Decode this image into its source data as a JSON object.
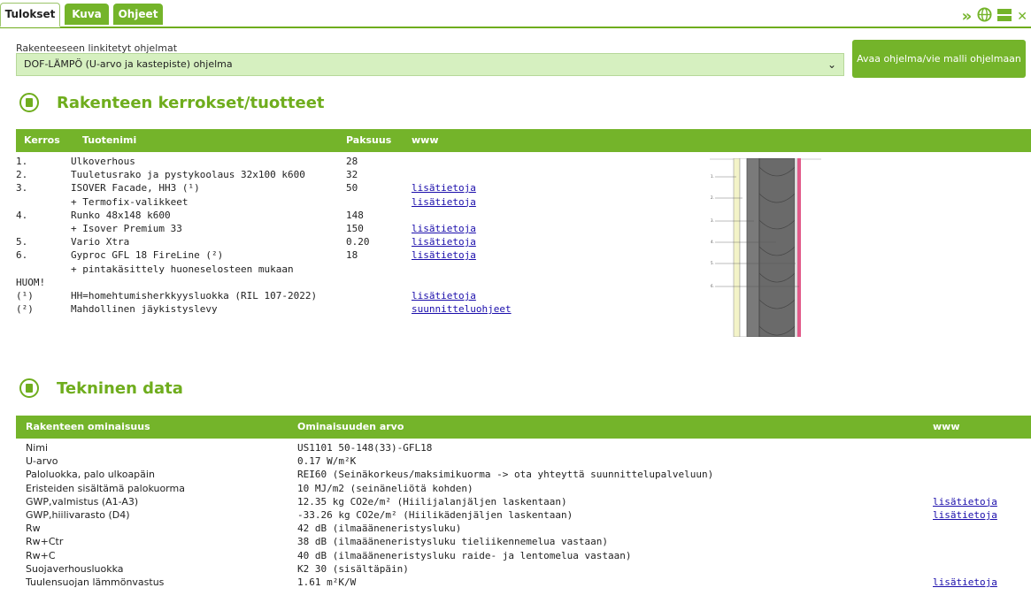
{
  "tabs": [
    {
      "label": "Tulokset",
      "active": true
    },
    {
      "label": "Kuva",
      "active": false
    },
    {
      "label": "Ohjeet",
      "active": false
    }
  ],
  "toolbar_icons": [
    "double-chevron-right-icon",
    "globe-icon",
    "menu-icon",
    "close-icon"
  ],
  "program": {
    "label": "Rakenteeseen linkitetyt ohjelmat",
    "selected": "DOF-LÄMPÖ (U-arvo ja kastepiste) ohjelma",
    "button": "Avaa ohjelma/vie malli ohjelmaan"
  },
  "layers": {
    "title": "Rakenteen kerrokset/tuotteet",
    "headers": {
      "kerros": "Kerros",
      "tuotenimi": "Tuotenimi",
      "paksuus": "Paksuus",
      "www": "www"
    },
    "rows": [
      {
        "k": "1.",
        "name": "Ulkoverhous",
        "p": "28",
        "w": ""
      },
      {
        "k": "2.",
        "name": "Tuuletusrako ja pystykoolaus 32x100 k600",
        "p": "32",
        "w": ""
      },
      {
        "k": "3.",
        "name": "ISOVER Facade, HH3 (¹)",
        "p": "50",
        "w": "lisätietoja"
      },
      {
        "k": "",
        "name": "+ Termofix-valikkeet",
        "p": "",
        "w": "lisätietoja"
      },
      {
        "k": "4.",
        "name": "Runko 48x148 k600",
        "p": "148",
        "w": ""
      },
      {
        "k": "",
        "name": "+ Isover Premium 33",
        "p": "150",
        "w": "lisätietoja"
      },
      {
        "k": "5.",
        "name": "Vario Xtra",
        "p": "0.20",
        "w": "lisätietoja"
      },
      {
        "k": "6.",
        "name": "Gyproc GFL 18 FireLine (²)",
        "p": "18",
        "w": "lisätietoja"
      },
      {
        "k": "",
        "name": "+ pintakäsittely huoneselosteen mukaan",
        "p": "",
        "w": ""
      },
      {
        "k": "HUOM!",
        "name": "",
        "p": "",
        "w": ""
      },
      {
        "k": "(¹)",
        "name": "HH=homehtumisherkkyysluokka (RIL 107-2022)",
        "p": "",
        "w": "lisätietoja"
      },
      {
        "k": "(²)",
        "name": "Mahdollinen jäykistyslevy",
        "p": "",
        "w": "suunnitteluohjeet"
      }
    ]
  },
  "diagram_labels": [
    "1.",
    "2.",
    "3.",
    "4.",
    "5.",
    "6."
  ],
  "tech": {
    "title": "Tekninen data",
    "headers": {
      "prop": "Rakenteen ominaisuus",
      "value": "Ominaisuuden arvo",
      "www": "www"
    },
    "rows": [
      {
        "prop": "Nimi",
        "value": "US1101 50-148(33)-GFL18",
        "w": ""
      },
      {
        "prop": "U-arvo",
        "value": "0.17 W/m²K",
        "w": ""
      },
      {
        "prop": "Paloluokka, palo ulkoapäin",
        "value": "REI60 (Seinäkorkeus/maksimikuorma -> ota yhteyttä suunnittelupalveluun)",
        "w": ""
      },
      {
        "prop": "Eristeiden sisältämä palokuorma",
        "value": "10 MJ/m2 (seinäneliötä kohden)",
        "w": ""
      },
      {
        "prop": "GWP,valmistus (A1-A3)",
        "value": "12.35 kg CO2e/m² (Hiilijalanjäljen laskentaan)",
        "w": "lisätietoja"
      },
      {
        "prop": "GWP,hiilivarasto (D4)",
        "value": "-33.26 kg CO2e/m² (Hiilikädenjäljen laskentaan)",
        "w": "lisätietoja"
      },
      {
        "prop": "Rw",
        "value": "42 dB (ilmaääneneristysluku)",
        "w": ""
      },
      {
        "prop": "Rw+Ctr",
        "value": "38 dB (ilmaääneneristysluku tieliikennemelua vastaan)",
        "w": ""
      },
      {
        "prop": "Rw+C",
        "value": "40 dB (ilmaääneneristysluku raide- ja lentomelua vastaan)",
        "w": ""
      },
      {
        "prop": "Suojaverhousluokka",
        "value": "K2 30 (sisältäpäin)",
        "w": ""
      },
      {
        "prop": "Tuulensuojan lämmönvastus",
        "value": "1.61 m²K/W",
        "w": "lisätietoja"
      }
    ]
  }
}
